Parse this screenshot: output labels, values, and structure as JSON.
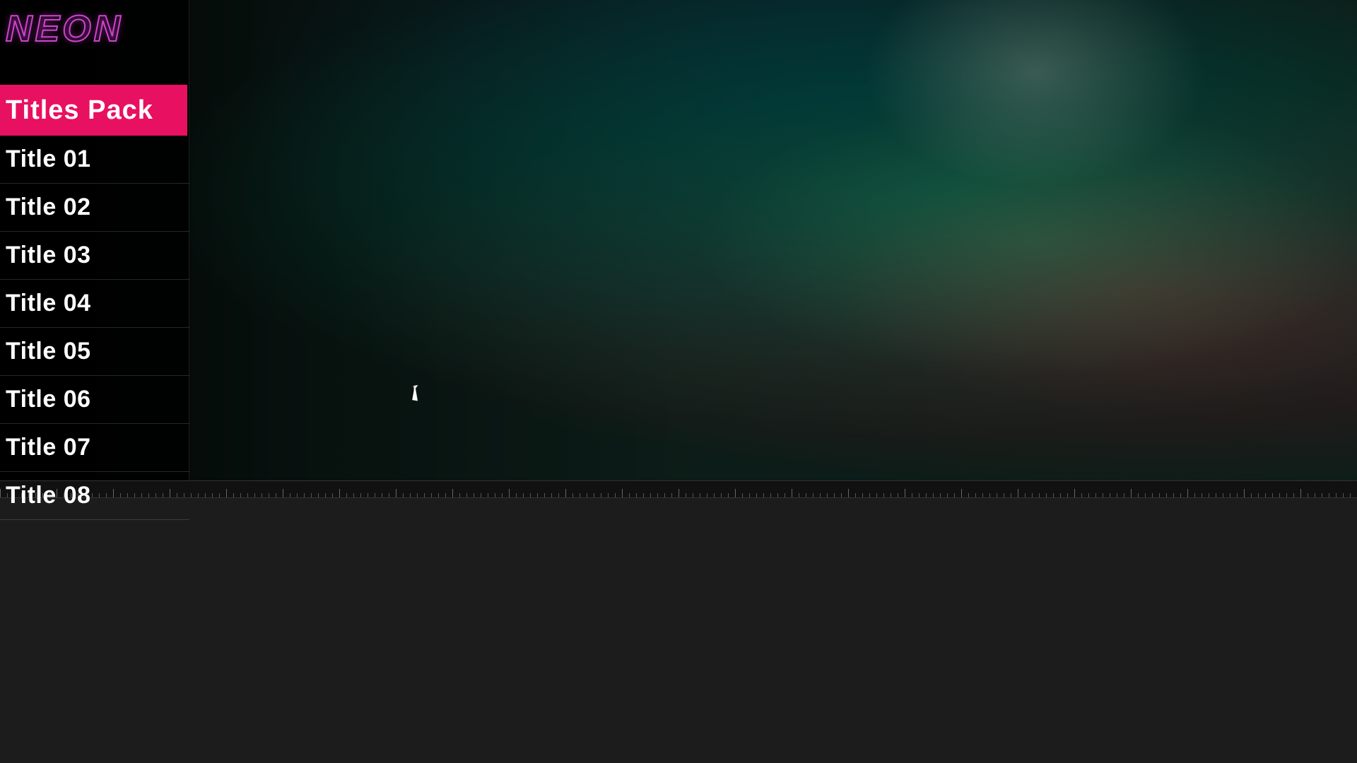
{
  "logo": {
    "text": "NEON"
  },
  "sidebar": {
    "header": {
      "label": "Titles Pack",
      "background_color": "#e81060"
    },
    "items": [
      {
        "id": 1,
        "label": "Title 01"
      },
      {
        "id": 2,
        "label": "Title 02"
      },
      {
        "id": 3,
        "label": "Title 03"
      },
      {
        "id": 4,
        "label": "Title 04"
      },
      {
        "id": 5,
        "label": "Title 05"
      },
      {
        "id": 6,
        "label": "Title 06"
      },
      {
        "id": 7,
        "label": "Title 07"
      },
      {
        "id": 8,
        "label": "Title 08"
      }
    ]
  },
  "timeline": {
    "ruler_ticks": 96
  }
}
